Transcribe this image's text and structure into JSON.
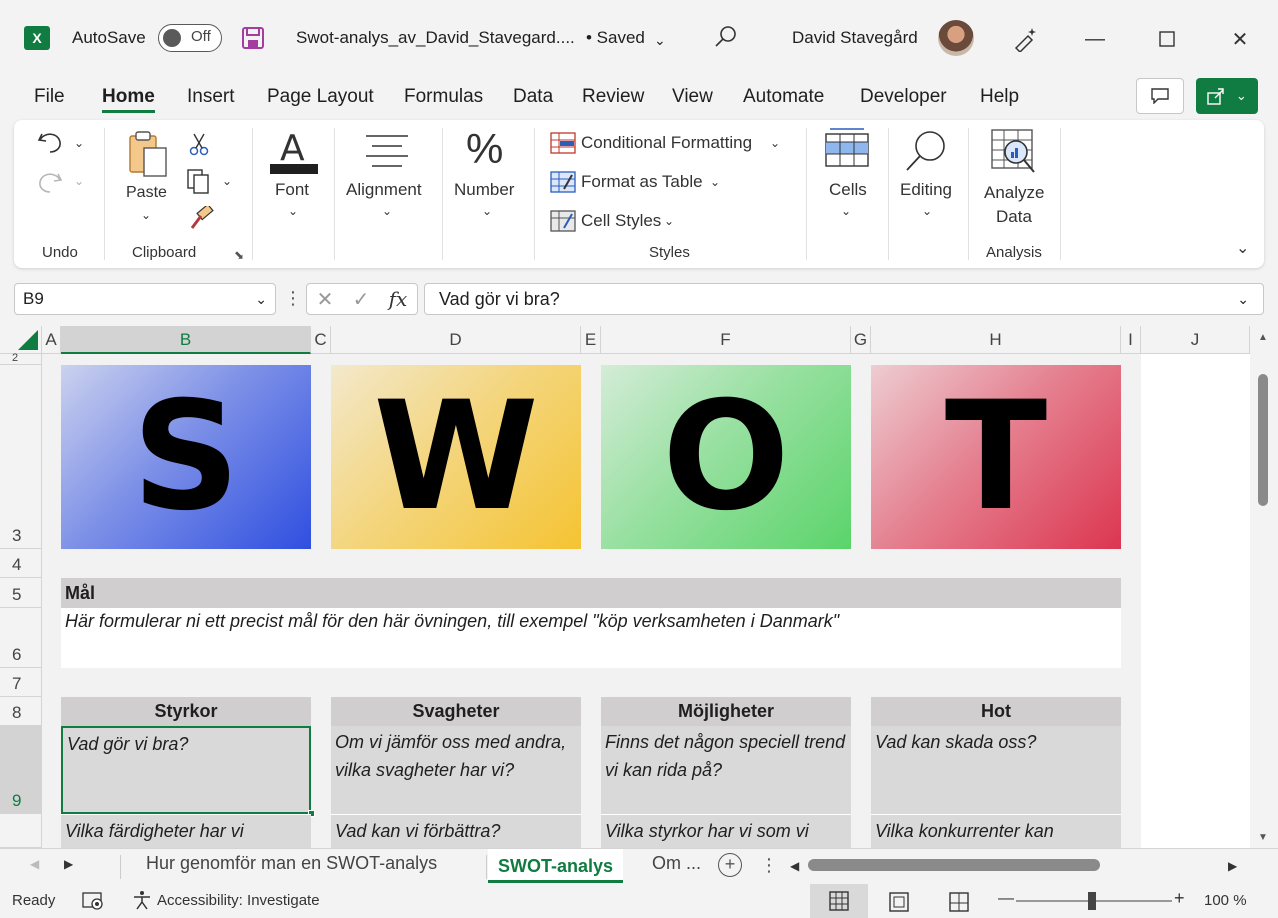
{
  "titlebar": {
    "app_icon": "excel-logo",
    "autosave_label": "AutoSave",
    "autosave_state": "Off",
    "filename": "Swot-analys_av_David_Stavegard....",
    "save_status": "• Saved",
    "user_name": "David Stavegård"
  },
  "menu": {
    "tabs": [
      "File",
      "Home",
      "Insert",
      "Page Layout",
      "Formulas",
      "Data",
      "Review",
      "View",
      "Automate",
      "Developer",
      "Help"
    ],
    "active": "Home"
  },
  "ribbon": {
    "groups": {
      "undo": "Undo",
      "clipboard": "Clipboard",
      "styles": "Styles",
      "analysis": "Analysis"
    },
    "paste_label": "Paste",
    "font_label": "Font",
    "alignment_label": "Alignment",
    "number_label": "Number",
    "conditional_formatting": "Conditional Formatting",
    "format_as_table": "Format as Table",
    "cell_styles": "Cell Styles",
    "cells_label": "Cells",
    "editing_label": "Editing",
    "analyze_label_1": "Analyze",
    "analyze_label_2": "Data"
  },
  "formula_bar": {
    "name_box": "B9",
    "fx": "fx",
    "formula": "Vad gör vi bra?"
  },
  "grid": {
    "columns": [
      "A",
      "B",
      "C",
      "D",
      "E",
      "F",
      "G",
      "H",
      "I",
      "J"
    ],
    "rows": [
      "2",
      "3",
      "4",
      "5",
      "6",
      "7",
      "8",
      "9"
    ],
    "selected_column": "B",
    "selected_row": "9",
    "swot_letters": [
      "S",
      "W",
      "O",
      "T"
    ],
    "swot_colors": {
      "s": "#2f4fe0",
      "w": "#f5c332",
      "o": "#5bd46a",
      "t": "#dc3650"
    },
    "goal_header": "Mål",
    "goal_text": "Här formulerar ni ett precist mål för den här övningen, till exempel \"köp verksamheten i Danmark\"",
    "categories": [
      "Styrkor",
      "Svagheter",
      "Möjligheter",
      "Hot"
    ],
    "row9": [
      "Vad gör vi bra?",
      "Om vi jämför oss med andra, vilka svagheter har vi?",
      "Finns det någon speciell trend vi kan rida på?",
      "Vad kan skada oss?"
    ],
    "row10": [
      "Vilka färdigheter har vi",
      "Vad kan vi förbättra?",
      "Vilka styrkor har vi som vi",
      "Vilka konkurrenter kan"
    ]
  },
  "sheets": {
    "tabs": [
      "Hur genomför man en SWOT-analys",
      "SWOT-analys",
      "Om ..."
    ],
    "active": "SWOT-analys"
  },
  "status": {
    "ready": "Ready",
    "accessibility": "Accessibility: Investigate",
    "zoom": "100 %",
    "zoom_level": 1.0
  },
  "accent_color": "#107c41"
}
